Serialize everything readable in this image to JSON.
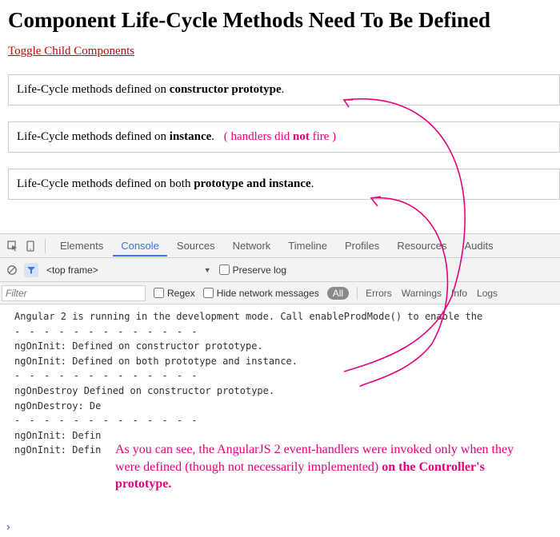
{
  "page": {
    "title": "Component Life-Cycle Methods Need To Be Defined",
    "toggle_link": "Toggle Child Components"
  },
  "boxes": {
    "box1_prefix": "Life-Cycle methods defined on ",
    "box1_bold": "constructor prototype",
    "box1_suffix": ".",
    "box2_prefix": "Life-Cycle methods defined on ",
    "box2_bold": "instance",
    "box2_suffix": ".",
    "box2_note_open": "( handlers did ",
    "box2_note_bold": "not",
    "box2_note_close": " fire )",
    "box3_prefix": "Life-Cycle methods defined on both ",
    "box3_bold": "prototype and instance",
    "box3_suffix": "."
  },
  "devtools": {
    "tabs": {
      "elements": "Elements",
      "console": "Console",
      "sources": "Sources",
      "network": "Network",
      "timeline": "Timeline",
      "profiles": "Profiles",
      "resources": "Resources",
      "audits": "Audits"
    },
    "context": "<top frame>",
    "preserve_log": "Preserve log",
    "filter_placeholder": "Filter",
    "regex": "Regex",
    "hide_net": "Hide network messages",
    "level_all": "All",
    "level_errors": "Errors",
    "level_warnings": "Warnings",
    "level_info": "Info",
    "level_logs": "Logs"
  },
  "console": {
    "line1": "Angular 2 is running in the development mode. Call enableProdMode() to enable the",
    "dash": "- - - - - - - - - - - - -",
    "line2": "ngOnInit: Defined on constructor prototype.",
    "line3": "ngOnInit: Defined on both prototype and instance.",
    "line4": "ngOnDestroy Defined on constructor prototype.",
    "line5": "ngOnDestroy: De",
    "line6": "ngOnInit: Defin",
    "line7": "ngOnInit: Defin"
  },
  "annotation": {
    "part1": "As you can see, the AngularJS 2 event-handlers were invoked only when they were defined (though not necessarily implemented) ",
    "bold": "on the Controller's prototype."
  }
}
